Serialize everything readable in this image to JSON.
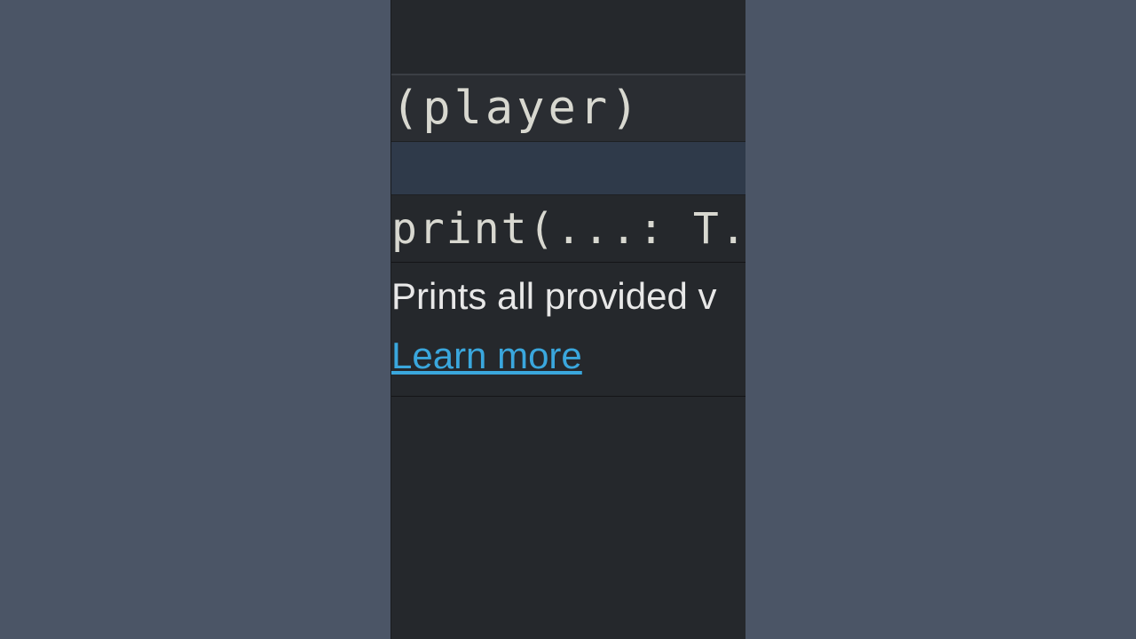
{
  "editor": {
    "code_fragment": "(player)"
  },
  "tooltip": {
    "signature_fragment": "print(...: T..",
    "description_fragment": "Prints all provided v",
    "learn_more_fragment": "Learn more"
  },
  "colors": {
    "sidebar": "#4b5566",
    "editor_bg": "#25282c",
    "code_line_bg": "#2a2d32",
    "cursor_line_bg": "#2f3a4a",
    "text": "#d8d8d0",
    "link": "#3aa7dd"
  }
}
